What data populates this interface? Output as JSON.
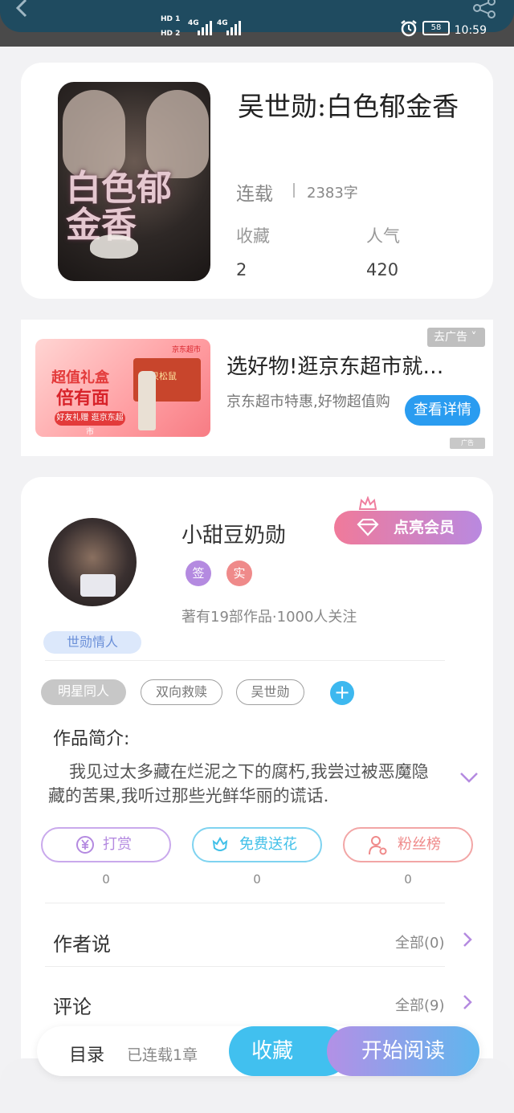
{
  "status_bar": {
    "hd1": "HD 1",
    "hd2": "HD 2",
    "net1": "4G",
    "net2": "4G",
    "battery": "58",
    "time": "10:59"
  },
  "header": {
    "back_icon": "chevron-left-icon",
    "share_icon": "share-icon"
  },
  "book": {
    "cover_title": "白色郁金香",
    "title": "吴世勋:白色郁金香",
    "status": "连载",
    "words": "2383字",
    "favorites_label": "收藏",
    "favorites_value": "2",
    "popularity_label": "人气",
    "popularity_value": "420"
  },
  "ad": {
    "close_label": "去广告 ˅",
    "image_title": "超值礼盒",
    "image_subtitle": "倍有面",
    "image_tag": "好友礼赠 逛京东超市",
    "image_brand": "京东超市",
    "image_box": "三只松鼠",
    "title": "选好物!逛京东超市就…",
    "description": "京东超市特惠,好物超值购",
    "button": "查看详情",
    "ad_tag": "广告"
  },
  "author": {
    "name": "小甜豆奶勋",
    "badge1": "签",
    "badge2": "实",
    "meta": "著有19部作品·1000人关注",
    "vip_button": "点亮会员",
    "fan_tag": "世勋情人"
  },
  "tags": [
    "明星同人",
    "双向救赎",
    "吴世勋"
  ],
  "intro": {
    "label": "作品简介:",
    "text": "我见过太多藏在烂泥之下的腐朽,我尝过被恶魔隐藏的苦果,我听过那些光鲜华丽的谎话."
  },
  "actions": [
    {
      "label": "打赏",
      "count": "0",
      "icon": "yen-coin-icon",
      "color": "#b48ae0"
    },
    {
      "label": "免费送花",
      "count": "0",
      "icon": "flower-icon",
      "color": "#41c0e8"
    },
    {
      "label": "粉丝榜",
      "count": "0",
      "icon": "user-rank-icon",
      "color": "#ef8a8a"
    }
  ],
  "rows": {
    "author_says": "作者说",
    "author_says_all": "全部(0)",
    "comments": "评论",
    "comments_all": "全部(9)"
  },
  "bottom": {
    "toc": "目录",
    "toc_meta": "已连载1章",
    "favorite": "收藏",
    "read": "开始阅读"
  }
}
